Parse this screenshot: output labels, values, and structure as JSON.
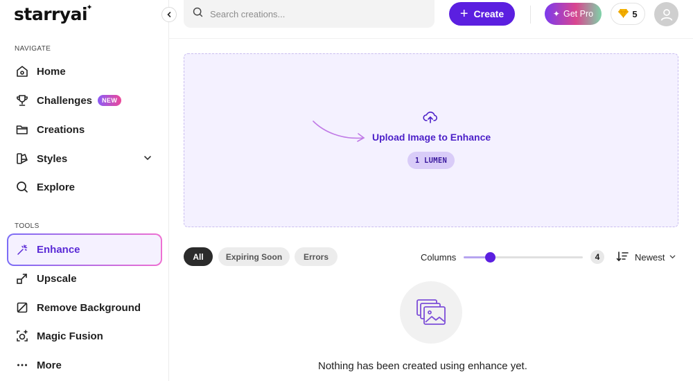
{
  "app": {
    "logo": "starryai"
  },
  "search": {
    "placeholder": "Search creations..."
  },
  "header": {
    "create_label": "Create",
    "pro_label": "Get Pro",
    "credits": "5"
  },
  "sidebar": {
    "navigate_label": "NAVIGATE",
    "tools_label": "TOOLS",
    "nav_items": [
      {
        "label": "Home",
        "icon": "home-icon"
      },
      {
        "label": "Challenges",
        "icon": "trophy-icon",
        "badge": "NEW"
      },
      {
        "label": "Creations",
        "icon": "folder-icon"
      },
      {
        "label": "Styles",
        "icon": "palette-icon"
      },
      {
        "label": "Explore",
        "icon": "search-icon"
      }
    ],
    "tool_items": [
      {
        "label": "Enhance",
        "icon": "magic-wand-icon",
        "active": true
      },
      {
        "label": "Upscale",
        "icon": "upscale-icon"
      },
      {
        "label": "Remove Background",
        "icon": "remove-background-icon"
      },
      {
        "label": "Magic Fusion",
        "icon": "magic-fusion-icon"
      },
      {
        "label": "More",
        "icon": "more-icon"
      }
    ]
  },
  "upload": {
    "label": "Upload Image to Enhance",
    "cost": "1 LUMEN"
  },
  "filters": {
    "chips": [
      "All",
      "Expiring Soon",
      "Errors"
    ],
    "active_chip": "All",
    "columns_label": "Columns",
    "columns_value": "4",
    "columns_fraction": 0.22,
    "sort_label": "Newest"
  },
  "empty_state": {
    "message": "Nothing has been created using enhance yet."
  },
  "colors": {
    "accent": "#5b1fe0",
    "upload_bg": "#f4f1ff",
    "active_text": "#5a2ad6"
  }
}
